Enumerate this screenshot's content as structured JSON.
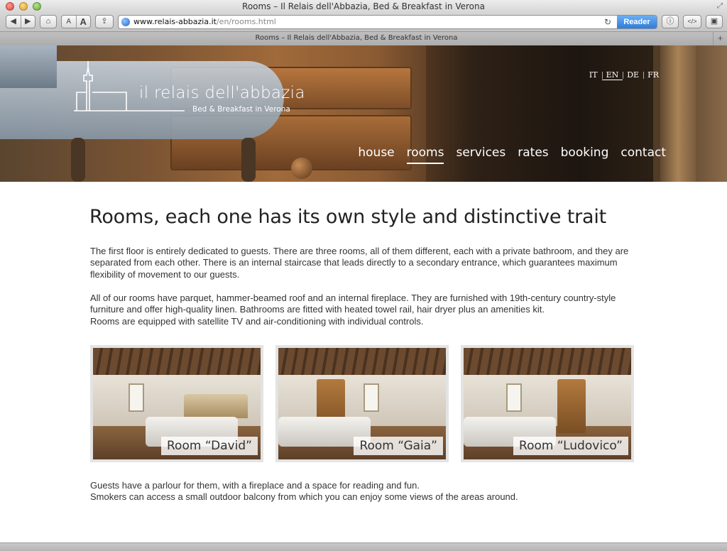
{
  "window": {
    "title": "Rooms – Il Relais dell'Abbazia, Bed & Breakfast in Verona"
  },
  "toolbar": {
    "back_icon": "arrow-left-icon",
    "forward_icon": "arrow-right-icon",
    "home_icon": "home-icon",
    "font_small": "A",
    "font_large": "A",
    "share_icon": "share-icon",
    "url_domain": "www.relais-abbazia.it",
    "url_path": "/en/rooms.html",
    "reader_label": "Reader",
    "info_icon": "info-icon",
    "devtools_label": "</>",
    "screenshot_icon": "camera-icon"
  },
  "tab": {
    "title": "Rooms – Il Relais dell'Abbazia, Bed & Breakfast in Verona",
    "new_tab_label": "+"
  },
  "site": {
    "logo_name": "il relais dell'abbazia",
    "logo_tagline": "Bed & Breakfast in Verona",
    "languages": [
      "IT",
      "EN",
      "DE",
      "FR"
    ],
    "active_language": "EN",
    "nav": [
      "house",
      "rooms",
      "services",
      "rates",
      "booking",
      "contact"
    ],
    "active_nav": "rooms"
  },
  "content": {
    "heading": "Rooms, each one has its own style and distinctive trait",
    "para1": "The first floor is entirely dedicated to guests. There are three rooms, all of them different, each with a private bathroom, and they are separated from each other. There is an internal staircase that leads directly to a secondary entrance, which guarantees maximum flexibility of movement to our guests.",
    "para2_lines": [
      "All of our rooms have parquet, hammer-beamed roof and an internal fireplace. They are furnished with 19th-century country-style furniture and offer high-quality linen. Bathrooms are fitted with heated towel rail, hair dryer plus an amenities kit.",
      "Rooms are equipped with satellite TV and air-conditioning with individual controls."
    ],
    "rooms": [
      {
        "label": "Room “David”"
      },
      {
        "label": "Room “Gaia”"
      },
      {
        "label": "Room “Ludovico”"
      }
    ],
    "para3_lines": [
      "Guests have a parlour for them, with a fireplace and a space for reading and fun.",
      "Smokers can access a small outdoor balcony from which you can enjoy some views of the areas around."
    ]
  },
  "colors": {
    "accent": "#2f7cd9",
    "text": "#333333",
    "heading": "#222222",
    "card_frame": "#e3e3e3"
  }
}
